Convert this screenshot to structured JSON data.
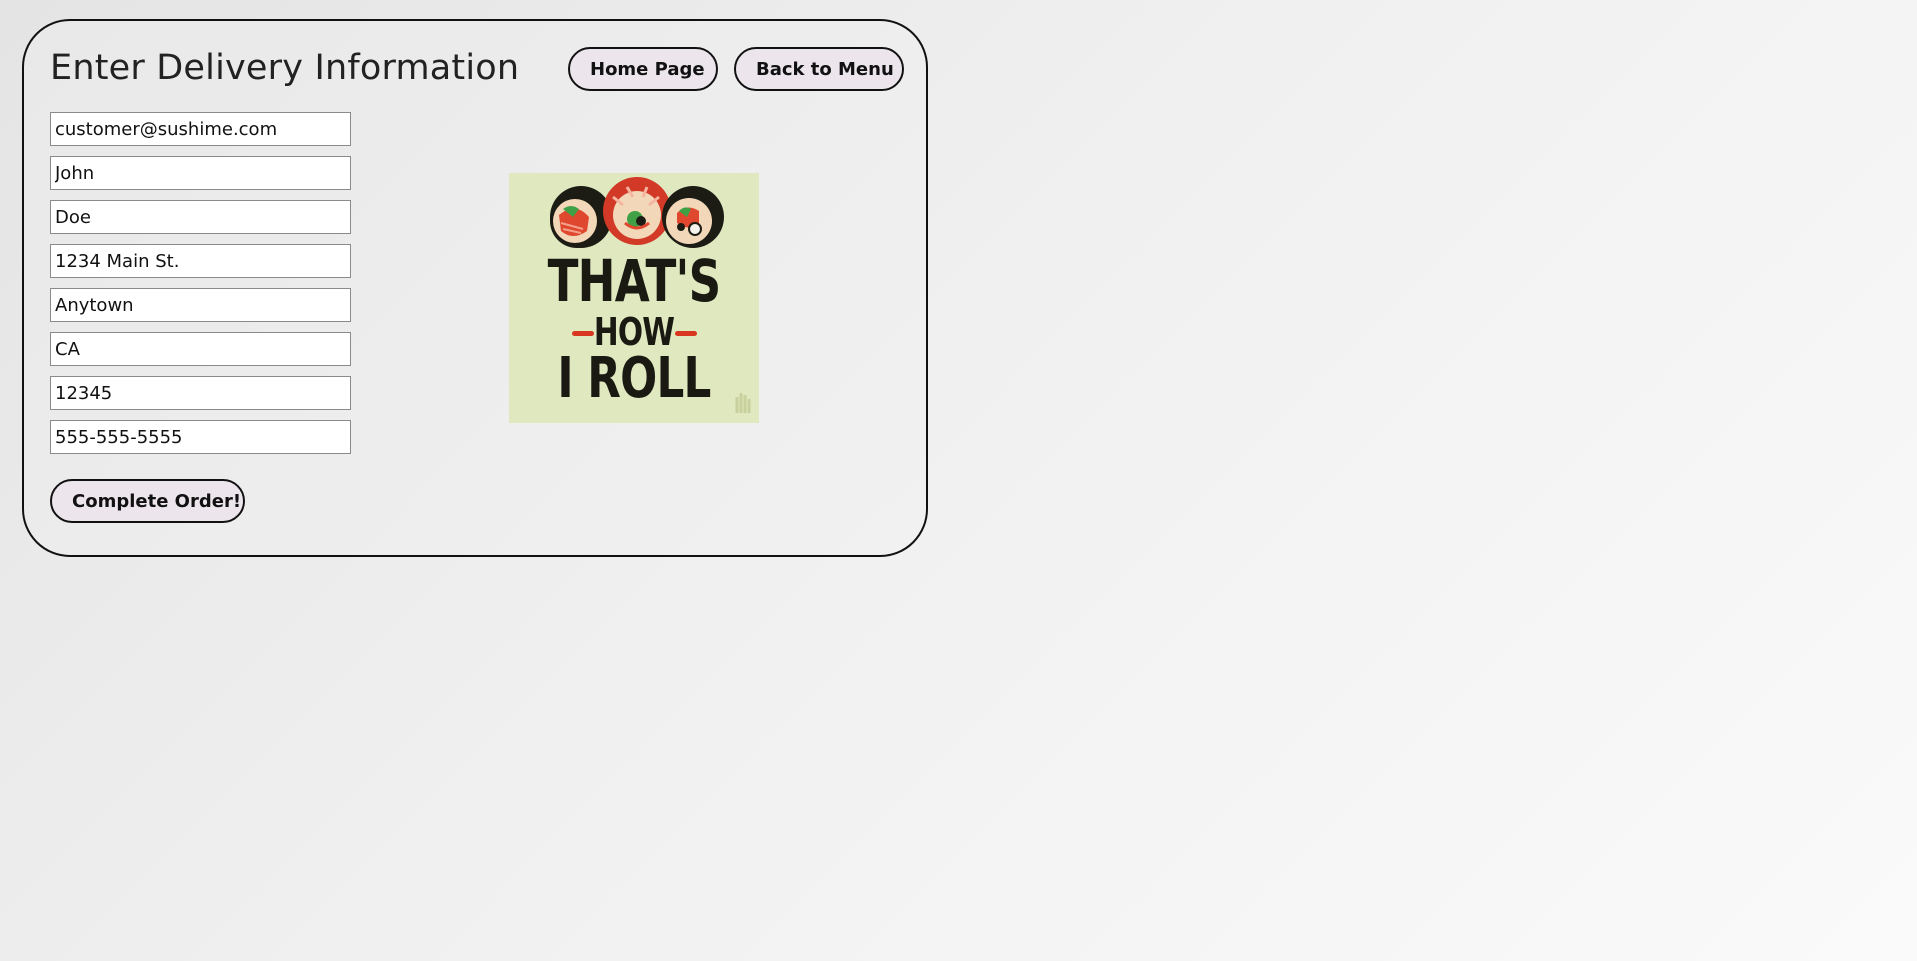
{
  "page": {
    "title": "Enter Delivery Information"
  },
  "nav": {
    "home_label": "Home Page",
    "menu_label": "Back to Menu"
  },
  "form": {
    "email": "customer@sushime.com",
    "first_name": "John",
    "last_name": "Doe",
    "address": "1234 Main St.",
    "city": "Anytown",
    "state": "CA",
    "zip": "12345",
    "phone": "555-555-5555",
    "submit_label": "Complete Order!"
  },
  "poster": {
    "line1": "THAT'S",
    "line2": "HOW",
    "line3": "I ROLL"
  },
  "colors": {
    "button_bg": "#ece6ec",
    "poster_bg": "#dfe8bf",
    "accent_red": "#d9361f"
  }
}
